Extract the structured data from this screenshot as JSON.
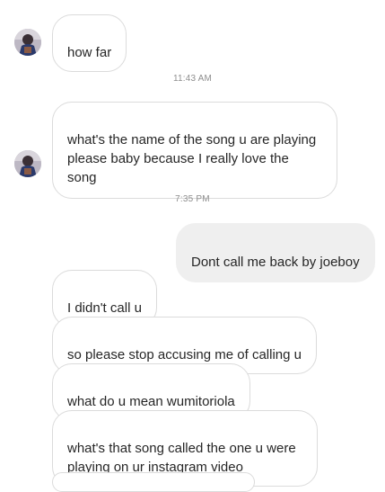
{
  "thread": {
    "timestamps": [
      "11:43 AM",
      "7:35 PM"
    ],
    "messages": [
      {
        "from": "them",
        "text": "how far"
      },
      {
        "from": "them",
        "text": "what's the name of the song u are playing\nplease baby because I really love the\nsong"
      },
      {
        "from": "me",
        "text": "Dont call me back by joeboy"
      },
      {
        "from": "them",
        "text": "I didn't call u"
      },
      {
        "from": "them",
        "text": "so please stop accusing me of calling u"
      },
      {
        "from": "them",
        "text": "what do u mean wumitoriola"
      },
      {
        "from": "them",
        "text": "what's that song called the one u were\nplaying on ur instagram video"
      }
    ]
  },
  "avatar": {
    "icon": "user-avatar-icon"
  },
  "colors": {
    "received_border": "#dbdbdb",
    "sent_background": "#efefef",
    "timestamp": "#8e8e8e",
    "text": "#262626"
  }
}
